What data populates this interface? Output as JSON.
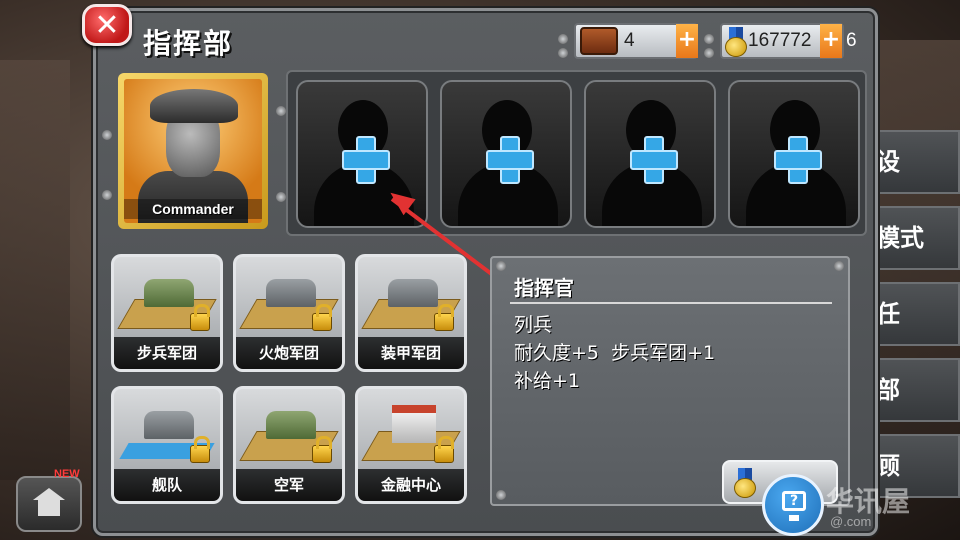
{
  "header": {
    "title": "指挥部",
    "close_icon": "close-x-icon"
  },
  "resources": {
    "supply": {
      "value": "4",
      "plus": "+",
      "icon": "supply-crate-icon"
    },
    "medals": {
      "value": "167772",
      "plus": "+",
      "trailing": "6",
      "icon": "medal-icon"
    }
  },
  "commander": {
    "name": "Commander"
  },
  "slots": [
    {
      "icon": "add-general-plus-icon"
    },
    {
      "icon": "add-general-plus-icon"
    },
    {
      "icon": "add-general-plus-icon"
    },
    {
      "icon": "add-general-plus-icon"
    }
  ],
  "corps": [
    {
      "label": "步兵军团",
      "locked": true
    },
    {
      "label": "火炮军团",
      "locked": true
    },
    {
      "label": "装甲军团",
      "locked": true
    },
    {
      "label": "舰队",
      "locked": true
    },
    {
      "label": "空军",
      "locked": true
    },
    {
      "label": "金融中心",
      "locked": true
    }
  ],
  "info": {
    "title": "指挥官",
    "lines": [
      "列兵",
      "耐久度+5  步兵军团+1",
      "补给+1"
    ]
  },
  "home": {
    "badge": "NEW"
  },
  "side_tabs": [
    "设",
    "模式",
    "任",
    "部",
    "顾"
  ],
  "watermark": {
    "main": "华讯屋",
    "sub": "@.com"
  },
  "colors": {
    "accent_blue": "#35a7e6",
    "arrow_red": "#e23232",
    "plus_orange": "#e8771a",
    "commander_gold": "#c99a1c"
  }
}
